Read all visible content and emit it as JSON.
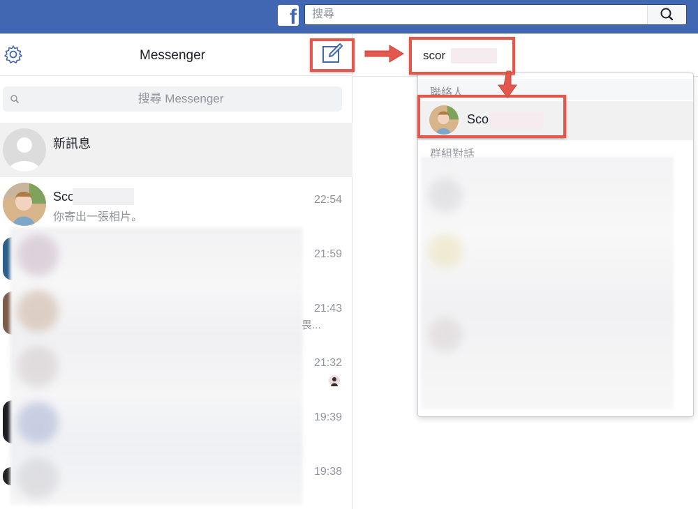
{
  "topbar": {
    "logo_letter": "f",
    "search_placeholder": "搜尋",
    "search_icon": "search-icon",
    "color": "#4267b2"
  },
  "sidebar": {
    "settings_icon": "gear-icon",
    "title": "Messenger",
    "compose_icon": "compose-icon",
    "search_placeholder": "搜尋 Messenger",
    "conversations": [
      {
        "name": "新訊息",
        "preview": "",
        "time": "",
        "active": true
      },
      {
        "name": "Sco",
        "preview": "你寄出一張相片。",
        "time": "22:54",
        "active": false
      },
      {
        "name": "",
        "preview": "",
        "time": "21:59",
        "active": false
      },
      {
        "name": "",
        "preview": "",
        "time": "21:43",
        "active": false
      },
      {
        "name": "",
        "preview": "",
        "time": "21:32",
        "active": false
      },
      {
        "name": "",
        "preview": "",
        "time": "19:39",
        "active": false
      },
      {
        "name": "",
        "preview": "",
        "time": "19:38",
        "active": false
      }
    ],
    "truncated_text": "畏..."
  },
  "new_message": {
    "to_value": "scor",
    "dropdown": {
      "contacts_header": "聯絡人",
      "contact_name": "Sco",
      "groups_header": "群組對話"
    }
  },
  "annotation_color": "#e4574d"
}
